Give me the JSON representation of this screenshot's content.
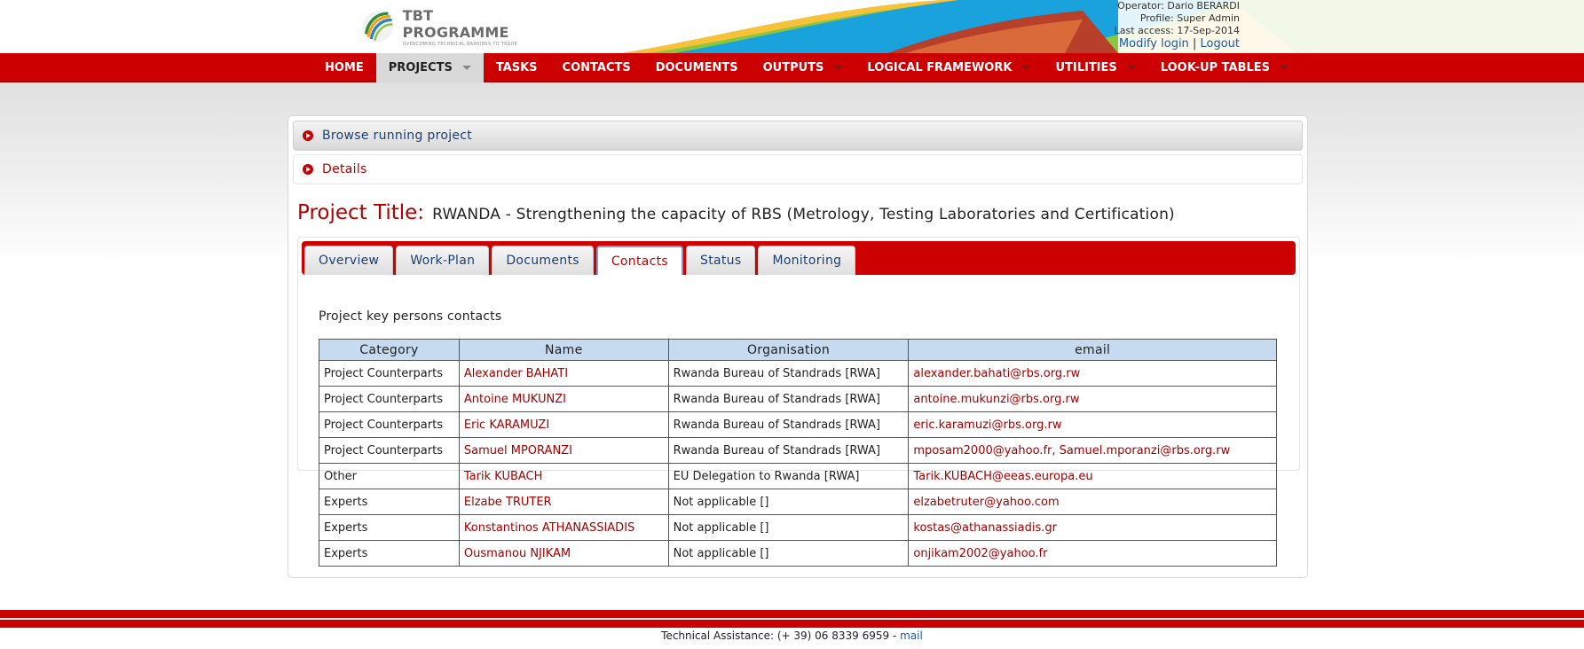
{
  "header": {
    "logo_title": "TBT PROGRAMME",
    "logo_subtitle": "OVERCOMING TECHNICAL BARRIERS TO TRADE",
    "operator": "Operator: Dario BERARDI",
    "profile": "Profile: Super Admin",
    "last_access": "Last access: 17-Sep-2014",
    "modify_login": "Modify login",
    "separator": "|",
    "logout": "Logout"
  },
  "nav": {
    "items": [
      {
        "label": "HOME",
        "has_dropdown": false,
        "active": false
      },
      {
        "label": "PROJECTS",
        "has_dropdown": true,
        "active": true
      },
      {
        "label": "TASKS",
        "has_dropdown": false,
        "active": false
      },
      {
        "label": "CONTACTS",
        "has_dropdown": false,
        "active": false
      },
      {
        "label": "DOCUMENTS",
        "has_dropdown": false,
        "active": false
      },
      {
        "label": "OUTPUTS",
        "has_dropdown": true,
        "active": false
      },
      {
        "label": "LOGICAL FRAMEWORK",
        "has_dropdown": true,
        "active": false
      },
      {
        "label": "UTILITIES",
        "has_dropdown": true,
        "active": false
      },
      {
        "label": "LOOK-UP TABLES",
        "has_dropdown": true,
        "active": false
      }
    ]
  },
  "accordion": {
    "browse_label": "Browse running project",
    "details_label": "Details"
  },
  "project": {
    "title_label": "Project Title:",
    "title_value": "RWANDA - Strengthening the capacity of RBS (Metrology, Testing Laboratories and Certification)"
  },
  "tabs": [
    {
      "label": "Overview",
      "active": false
    },
    {
      "label": "Work-Plan",
      "active": false
    },
    {
      "label": "Documents",
      "active": false
    },
    {
      "label": "Contacts",
      "active": true
    },
    {
      "label": "Status",
      "active": false
    },
    {
      "label": "Monitoring",
      "active": false
    }
  ],
  "contacts": {
    "caption": "Project key persons contacts",
    "columns": [
      "Category",
      "Name",
      "Organisation",
      "email"
    ],
    "rows": [
      [
        "Project Counterparts",
        "Alexander BAHATI",
        "Rwanda Bureau of Standrads [RWA]",
        "alexander.bahati@rbs.org.rw"
      ],
      [
        "Project Counterparts",
        "Antoine MUKUNZI",
        "Rwanda Bureau of Standrads [RWA]",
        "antoine.mukunzi@rbs.org.rw"
      ],
      [
        "Project Counterparts",
        "Eric KARAMUZI",
        "Rwanda Bureau of Standrads [RWA]",
        "eric.karamuzi@rbs.org.rw"
      ],
      [
        "Project Counterparts",
        "Samuel MPORANZI",
        "Rwanda Bureau of Standrads [RWA]",
        "mposam2000@yahoo.fr, Samuel.mporanzi@rbs.org.rw"
      ],
      [
        "Other",
        "Tarik KUBACH",
        "EU Delegation to Rwanda [RWA]",
        "Tarik.KUBACH@eeas.europa.eu"
      ],
      [
        "Experts",
        "Elzabe TRUTER",
        "Not applicable []",
        "elzabetruter@yahoo.com"
      ],
      [
        "Experts",
        "Konstantinos ATHANASSIADIS",
        "Not applicable []",
        "kostas@athanassiadis.gr"
      ],
      [
        "Experts",
        "Ousmanou NJIKAM",
        "Not applicable []",
        "onjikam2002@yahoo.fr"
      ]
    ]
  },
  "footer": {
    "text": "Technical Assistance: (+ 39) 06 8339 6959 -",
    "mail_link": "mail"
  },
  "colors": {
    "brand_red": "#cc0000",
    "dark_red_text": "#a30000",
    "link_blue": "#1b5aa3",
    "table_header_bg": "#c6dbef"
  }
}
